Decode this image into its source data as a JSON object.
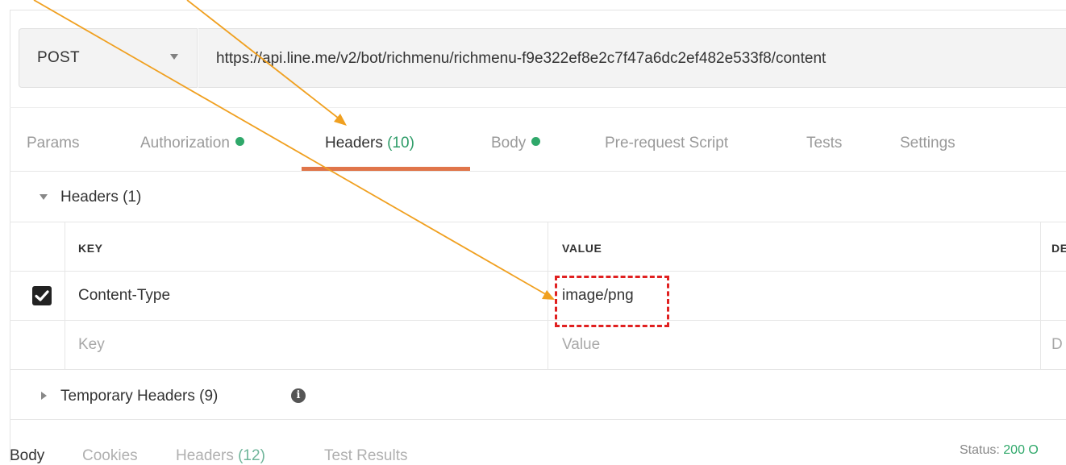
{
  "request": {
    "method": "POST",
    "url": "https://api.line.me/v2/bot/richmenu/richmenu-f9e322ef8e2c7f47a6dc2ef482e533f8/content"
  },
  "tabs": [
    {
      "label": "Params"
    },
    {
      "label": "Authorization"
    },
    {
      "label": "Headers",
      "count": "(10)"
    },
    {
      "label": "Body"
    },
    {
      "label": "Pre-request Script"
    },
    {
      "label": "Tests"
    },
    {
      "label": "Settings"
    }
  ],
  "headers_section": {
    "title": "Headers (1)",
    "columns": {
      "key": "KEY",
      "value": "VALUE",
      "description": "DE"
    },
    "rows": [
      {
        "checked": true,
        "key": "Content-Type",
        "value": "image/png"
      }
    ],
    "placeholder": {
      "key": "Key",
      "value": "Value",
      "description": "D"
    }
  },
  "temporary_headers": {
    "title": "Temporary Headers (9)",
    "info_icon": "i"
  },
  "response_tabs": [
    {
      "label": "Body"
    },
    {
      "label": "Cookies"
    },
    {
      "label": "Headers",
      "count": "(12)"
    },
    {
      "label": "Test Results"
    }
  ],
  "status": {
    "label": "Status:",
    "code": "200 O"
  },
  "colors": {
    "accent_underline": "#e0754a",
    "status_green": "#2fa86a",
    "annotation_arrow": "#f0a020",
    "highlight_box": "#e02020"
  }
}
